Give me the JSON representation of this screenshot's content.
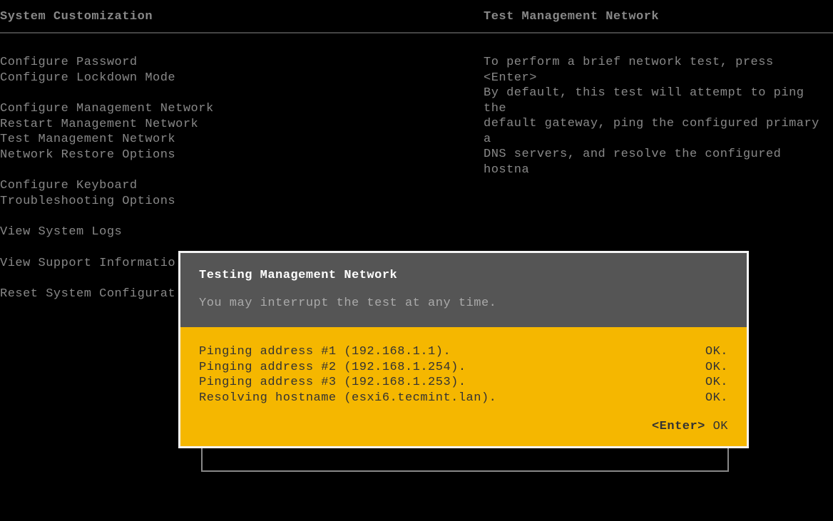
{
  "header": {
    "left_title": "System Customization",
    "right_title": "Test Management Network"
  },
  "menu": {
    "group1": [
      "Configure Password",
      "Configure Lockdown Mode"
    ],
    "group2": [
      "Configure Management Network",
      "Restart Management Network",
      "Test Management Network",
      "Network Restore Options"
    ],
    "group3": [
      "Configure Keyboard",
      "Troubleshooting Options"
    ],
    "group4": [
      "View System Logs"
    ],
    "group5": [
      "View Support Informatio"
    ],
    "group6": [
      "Reset System Configurat"
    ]
  },
  "description": {
    "line1": "To perform a brief network test, press <Enter>",
    "line2": "",
    "line3": "By default, this test will attempt to ping the",
    "line4": "default gateway, ping the configured primary a",
    "line5": "DNS servers, and resolve the configured hostna"
  },
  "dialog": {
    "title": "Testing Management Network",
    "subtitle": "You may interrupt the test at any time.",
    "tests": [
      {
        "label": "Pinging address #1 (192.168.1.1).",
        "result": "OK."
      },
      {
        "label": "Pinging address #2 (192.168.1.254).",
        "result": "OK."
      },
      {
        "label": "Pinging address #3 (192.168.1.253).",
        "result": "OK."
      },
      {
        "label": "Resolving hostname (esxi6.tecmint.lan).",
        "result": "OK."
      }
    ],
    "footer_enter": "<Enter>",
    "footer_ok": " OK"
  }
}
